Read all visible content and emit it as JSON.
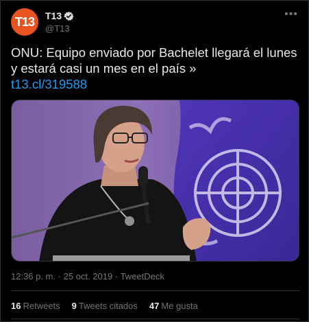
{
  "colors": {
    "background": "#000000",
    "brand": "#e9531f",
    "link": "#1d9bf0",
    "muted": "#71767b",
    "text": "#e7e9ea",
    "verified": "#d9d9d9"
  },
  "author": {
    "avatar_text": "T13",
    "display_name": "T13",
    "handle": "@T13",
    "verified_icon": "verified-badge-icon",
    "more_icon": "more-options-icon"
  },
  "tweet": {
    "text": "ONU: Equipo enviado por Bachelet llegará el lunes y estará casi un mes en el país »",
    "link": "t13.cl/319588",
    "media_icon": "news-photo"
  },
  "meta": {
    "time": "12:36 p. m.",
    "separator": "·",
    "date": "25 oct. 2019",
    "source": "TweetDeck"
  },
  "stats": {
    "retweets_count": "16",
    "retweets_label": "Retweets",
    "quotes_count": "9",
    "quotes_label": "Tweets citados",
    "likes_count": "47",
    "likes_label": "Me gusta"
  }
}
